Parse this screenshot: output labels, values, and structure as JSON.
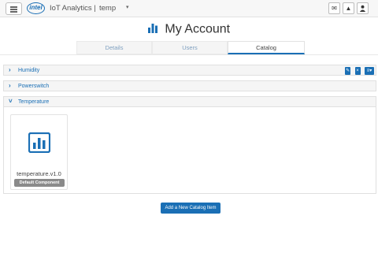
{
  "navbar": {
    "logo_text": "intel",
    "app_title": "IoT Analytics |",
    "account_name": "temp",
    "account_caret": "▾",
    "buttons": [
      {
        "icon": "mail-icon",
        "glyph": "✉"
      },
      {
        "icon": "bell-icon",
        "glyph": "▲"
      },
      {
        "icon": "user-icon",
        "glyph": "●"
      }
    ]
  },
  "page": {
    "title": "My Account",
    "title_icon": "bar-chart-icon",
    "accent_color": "#1a6fb5"
  },
  "tabs": [
    {
      "label": "Details",
      "active": false
    },
    {
      "label": "Users",
      "active": false
    },
    {
      "label": "Catalog",
      "active": true
    }
  ],
  "catalog": {
    "groups": [
      {
        "label": "Humidity",
        "expanded": false,
        "has_actions": true
      },
      {
        "label": "Powerswitch",
        "expanded": false,
        "has_actions": false
      },
      {
        "label": "Temperature",
        "expanded": true,
        "has_actions": false
      }
    ],
    "items": [
      {
        "name": "temperature.v1.0",
        "badge": "Default Component",
        "icon": "chart-icon"
      }
    ],
    "add_button_label": "Add a New Catalog Item"
  }
}
